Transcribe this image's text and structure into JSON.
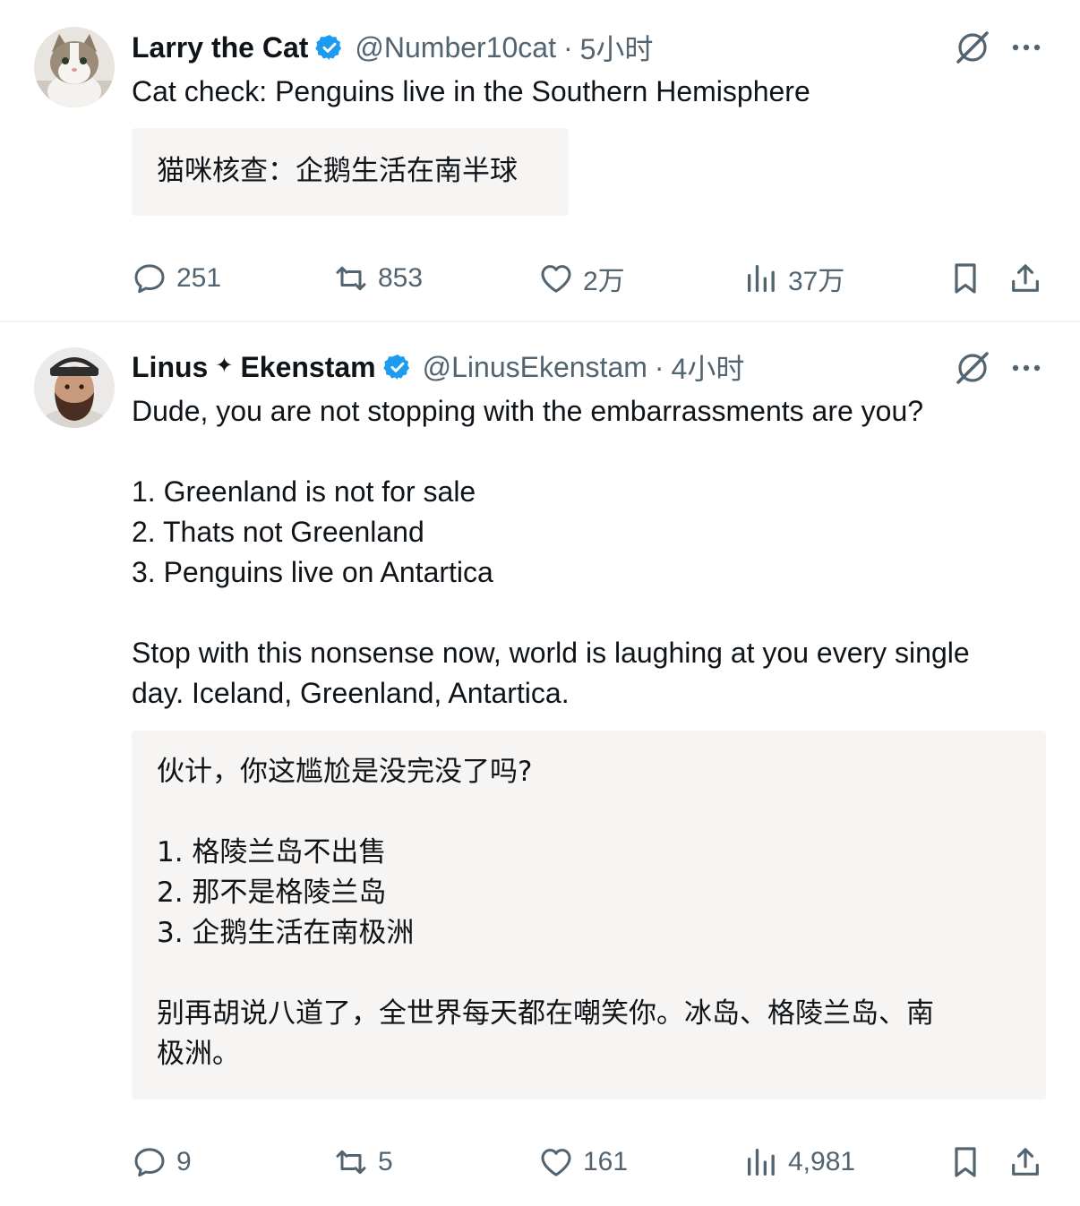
{
  "tweets": [
    {
      "author_name": "Larry the Cat",
      "handle": "@Number10cat",
      "separator": "·",
      "time": "5小时",
      "body": [
        "Cat check: Penguins live in the Southern Hemisphere"
      ],
      "translation": [
        "猫咪核查：企鹅生活在南半球"
      ],
      "actions": {
        "replies": "251",
        "retweets": "853",
        "likes": "2万",
        "views": "37万"
      }
    },
    {
      "author_first": "Linus",
      "author_sparkle": "✦",
      "author_last": "Ekenstam",
      "handle": "@LinusEkenstam",
      "separator": "·",
      "time": "4小时",
      "body": [
        "Dude, you are not stopping with the embarrassments are you?",
        "",
        "1. Greenland is not for sale",
        "2. Thats not Greenland",
        "3. Penguins live on Antartica",
        "",
        "Stop with this nonsense now, world is laughing at you every single",
        "day. Iceland, Greenland, Antartica."
      ],
      "translation": [
        "伙计，你这尴尬是没完没了吗?",
        "",
        "1. 格陵兰岛不出售",
        "2. 那不是格陵兰岛",
        "3. 企鹅生活在南极洲",
        "",
        "别再胡说八道了，全世界每天都在嘲笑你。冰岛、格陵兰岛、南",
        "极洲。"
      ],
      "actions": {
        "replies": "9",
        "retweets": "5",
        "likes": "161",
        "views": "4,981"
      }
    }
  ],
  "icons": {
    "verified": "verified-badge-icon",
    "grok": "grok-icon",
    "more": "more-icon",
    "reply": "reply-icon",
    "retweet": "retweet-icon",
    "like": "heart-icon",
    "views": "views-icon",
    "bookmark": "bookmark-icon",
    "share": "share-icon"
  },
  "colors": {
    "verified": "#1d9bf0",
    "secondary_text": "#536471",
    "translation_bg": "#f7f5f3"
  }
}
